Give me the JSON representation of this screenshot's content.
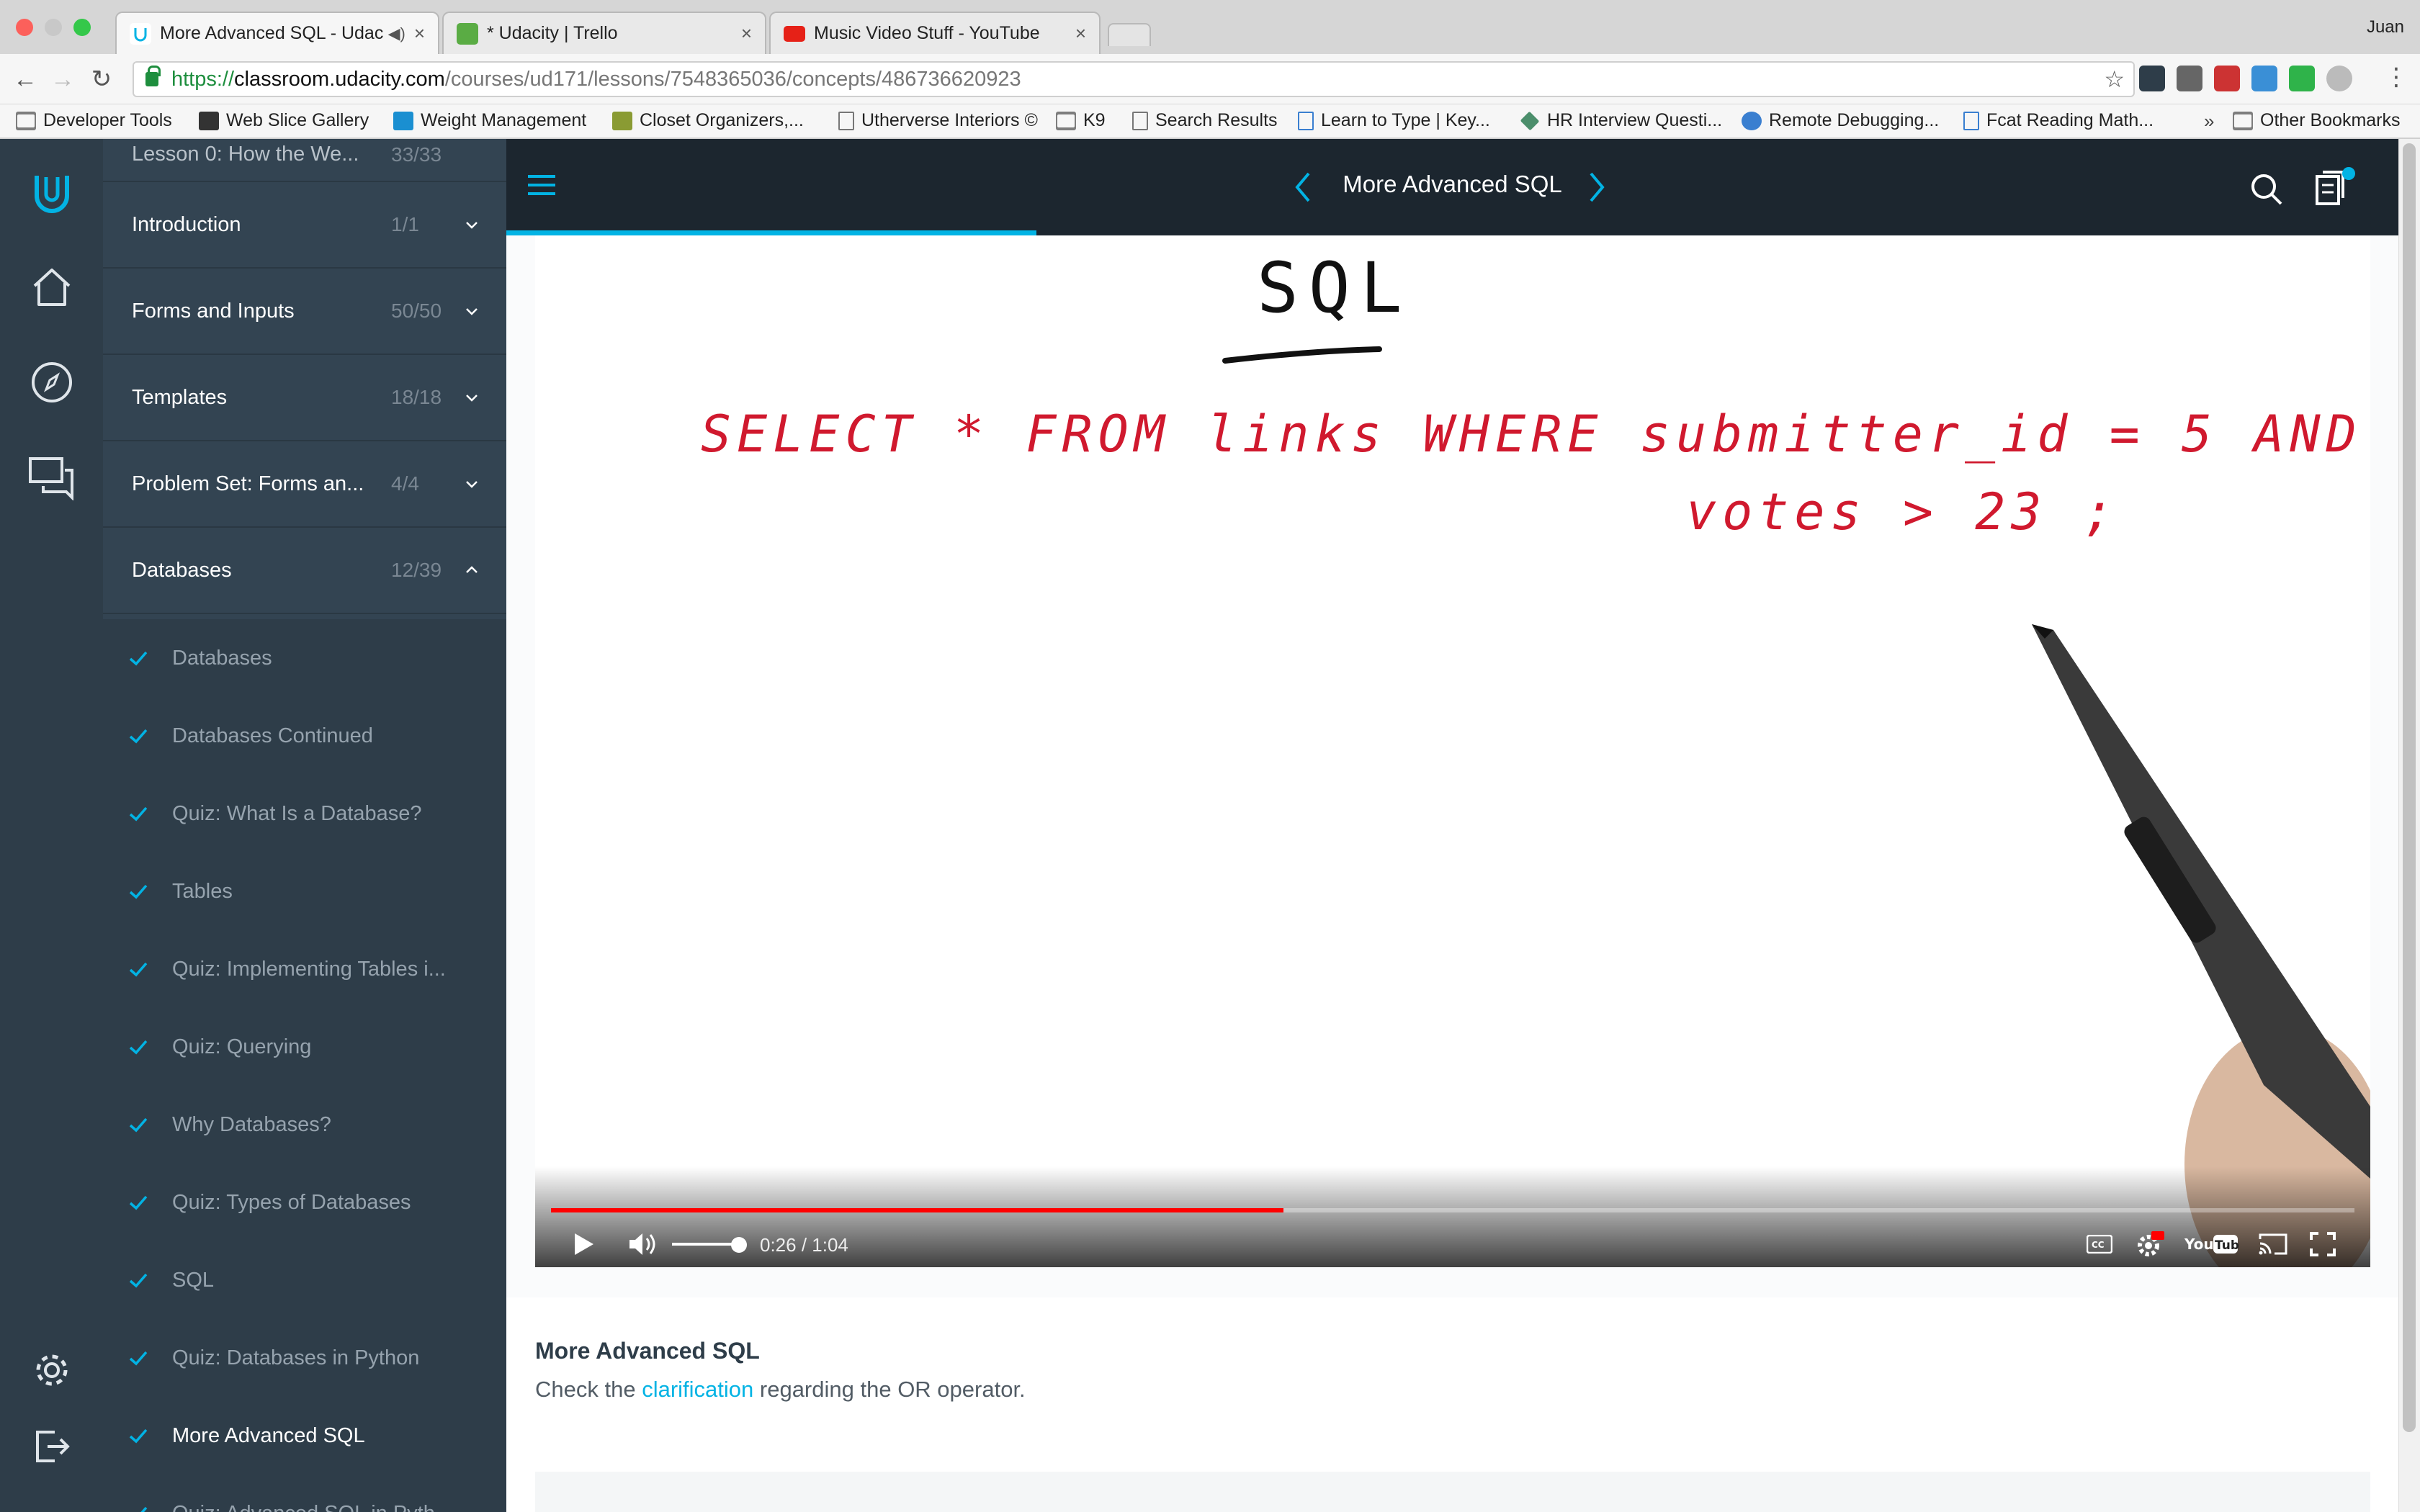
{
  "browser": {
    "tabs": [
      {
        "title": "More Advanced SQL - Udac",
        "favicon_color": "#02b3e4",
        "active": true
      },
      {
        "title": "* Udacity | Trello",
        "favicon_color": "#5aac44",
        "active": false
      },
      {
        "title": "Music Video Stuff - YouTube",
        "favicon_color": "#e62117",
        "active": false
      }
    ],
    "user": "Juan",
    "url": {
      "scheme": "https://",
      "host": "classroom.udacity.com",
      "path": "/courses/ud171/lessons/7548365036/concepts/486736620923"
    },
    "bookmarks": [
      {
        "label": "Developer Tools",
        "icon": "folder"
      },
      {
        "label": "Web Slice Gallery",
        "icon": "sq"
      },
      {
        "label": "Weight Management",
        "icon": "sq"
      },
      {
        "label": "Closet Organizers,...",
        "icon": "sq"
      },
      {
        "label": "Utherverse Interiors ©",
        "icon": "page"
      },
      {
        "label": "K9",
        "icon": "folder"
      },
      {
        "label": "Search Results",
        "icon": "page"
      },
      {
        "label": "Learn to Type | Key...",
        "icon": "page"
      },
      {
        "label": "HR Interview Questi...",
        "icon": "sq"
      },
      {
        "label": "Remote Debugging...",
        "icon": "sq"
      },
      {
        "label": "Fcat Reading Math...",
        "icon": "page"
      }
    ],
    "bookmarks_more": "»",
    "other_bookmarks": "Other Bookmarks"
  },
  "sidebar": {
    "partial_lesson": {
      "title": "Lesson 0: How the We...",
      "count": "33/33"
    },
    "lessons": [
      {
        "title": "Introduction",
        "count": "1/1",
        "expanded": false
      },
      {
        "title": "Forms and Inputs",
        "count": "50/50",
        "expanded": false
      },
      {
        "title": "Templates",
        "count": "18/18",
        "expanded": false
      },
      {
        "title": "Problem Set: Forms an...",
        "count": "4/4",
        "expanded": false
      },
      {
        "title": "Databases",
        "count": "12/39",
        "expanded": true
      }
    ],
    "concepts": [
      {
        "title": "Databases",
        "done": true
      },
      {
        "title": "Databases Continued",
        "done": true
      },
      {
        "title": "Quiz: What Is a Database?",
        "done": true
      },
      {
        "title": "Tables",
        "done": true
      },
      {
        "title": "Quiz: Implementing Tables i...",
        "done": true
      },
      {
        "title": "Quiz: Querying",
        "done": true
      },
      {
        "title": "Why Databases?",
        "done": true
      },
      {
        "title": "Quiz: Types of Databases",
        "done": true
      },
      {
        "title": "SQL",
        "done": true
      },
      {
        "title": "Quiz: Databases in Python",
        "done": true
      },
      {
        "title": "More Advanced SQL",
        "done": true,
        "current": true
      },
      {
        "title": "Quiz: Advanced SQL in Pyth...",
        "done": true
      }
    ]
  },
  "header": {
    "title": "More Advanced SQL",
    "lesson_progress": 0.28
  },
  "video": {
    "whiteboard": {
      "heading": "SQL",
      "line1": "SELECT * FROM links WHERE submitter_id = 5 AND",
      "line2": "votes > 23 ;"
    },
    "time": "0:26 / 1:04",
    "progress": 0.406,
    "volume": 0.9
  },
  "lesson_card": {
    "title": "More Advanced SQL",
    "text_before": "Check the",
    "link": "clarification",
    "text_after": "regarding the OR operator."
  },
  "colors": {
    "accent": "#02b3e4",
    "rail": "#2e3d49",
    "ink_red": "#d0192e"
  }
}
